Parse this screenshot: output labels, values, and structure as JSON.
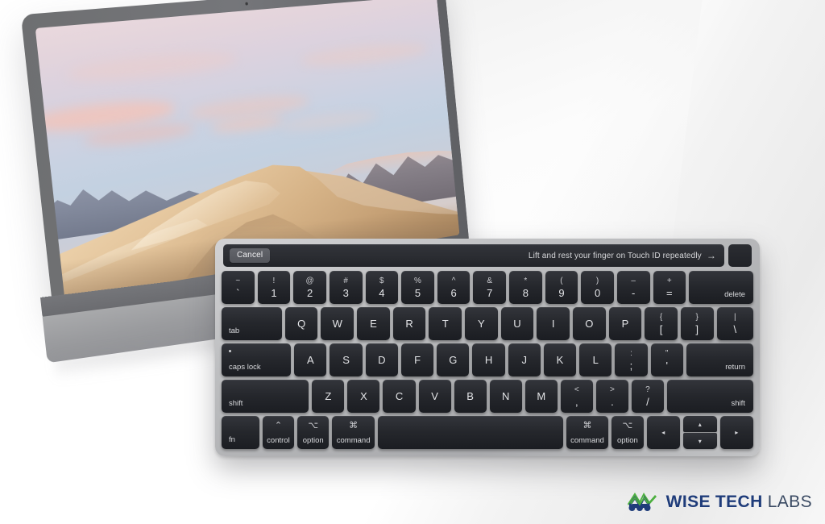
{
  "page": {
    "title": "MacBook Pro with Touch Bar — Touch ID enrollment"
  },
  "device": {
    "name": "macbook-pro",
    "wallpaper_name": "mojave-desert-dune",
    "bezel_color": "#6e6f71",
    "deck_color": "#9a9b9e"
  },
  "touchbar": {
    "cancel_label": "Cancel",
    "hint_text": "Lift and rest your finger on Touch ID repeatedly",
    "hint_arrow": "→",
    "background_color": "#2a2c31",
    "touchid_label": ""
  },
  "keyboard": {
    "body_color": "#bcbdbf",
    "key_color": "#25272c",
    "key_text_color": "#e3e4e7",
    "rows": [
      {
        "name": "number-row",
        "keys": [
          {
            "name": "key-backtick",
            "top": "~",
            "bottom": "`"
          },
          {
            "name": "key-1",
            "top": "!",
            "bottom": "1"
          },
          {
            "name": "key-2",
            "top": "@",
            "bottom": "2"
          },
          {
            "name": "key-3",
            "top": "#",
            "bottom": "3"
          },
          {
            "name": "key-4",
            "top": "$",
            "bottom": "4"
          },
          {
            "name": "key-5",
            "top": "%",
            "bottom": "5"
          },
          {
            "name": "key-6",
            "top": "^",
            "bottom": "6"
          },
          {
            "name": "key-7",
            "top": "&",
            "bottom": "7"
          },
          {
            "name": "key-8",
            "top": "*",
            "bottom": "8"
          },
          {
            "name": "key-9",
            "top": "(",
            "bottom": "9"
          },
          {
            "name": "key-0",
            "top": ")",
            "bottom": "0"
          },
          {
            "name": "key-minus",
            "top": "–",
            "bottom": "-"
          },
          {
            "name": "key-equal",
            "top": "+",
            "bottom": "="
          },
          {
            "name": "key-delete",
            "label": "delete"
          }
        ]
      },
      {
        "name": "top-letter-row",
        "keys": [
          {
            "name": "key-tab",
            "label": "tab"
          },
          {
            "name": "key-q",
            "label": "Q"
          },
          {
            "name": "key-w",
            "label": "W"
          },
          {
            "name": "key-e",
            "label": "E"
          },
          {
            "name": "key-r",
            "label": "R"
          },
          {
            "name": "key-t",
            "label": "T"
          },
          {
            "name": "key-y",
            "label": "Y"
          },
          {
            "name": "key-u",
            "label": "U"
          },
          {
            "name": "key-i",
            "label": "I"
          },
          {
            "name": "key-o",
            "label": "O"
          },
          {
            "name": "key-p",
            "label": "P"
          },
          {
            "name": "key-bracket-left",
            "top": "{",
            "bottom": "["
          },
          {
            "name": "key-bracket-right",
            "top": "}",
            "bottom": "]"
          },
          {
            "name": "key-backslash",
            "top": "|",
            "bottom": "\\"
          }
        ]
      },
      {
        "name": "home-row",
        "keys": [
          {
            "name": "key-caps-lock",
            "label": "caps lock"
          },
          {
            "name": "key-a",
            "label": "A"
          },
          {
            "name": "key-s",
            "label": "S"
          },
          {
            "name": "key-d",
            "label": "D"
          },
          {
            "name": "key-f",
            "label": "F"
          },
          {
            "name": "key-g",
            "label": "G"
          },
          {
            "name": "key-h",
            "label": "H"
          },
          {
            "name": "key-j",
            "label": "J"
          },
          {
            "name": "key-k",
            "label": "K"
          },
          {
            "name": "key-l",
            "label": "L"
          },
          {
            "name": "key-semicolon",
            "top": ":",
            "bottom": ";"
          },
          {
            "name": "key-quote",
            "top": "\"",
            "bottom": "'"
          },
          {
            "name": "key-return",
            "label": "return"
          }
        ]
      },
      {
        "name": "bottom-letter-row",
        "keys": [
          {
            "name": "key-shift-left",
            "label": "shift"
          },
          {
            "name": "key-z",
            "label": "Z"
          },
          {
            "name": "key-x",
            "label": "X"
          },
          {
            "name": "key-c",
            "label": "C"
          },
          {
            "name": "key-v",
            "label": "V"
          },
          {
            "name": "key-b",
            "label": "B"
          },
          {
            "name": "key-n",
            "label": "N"
          },
          {
            "name": "key-m",
            "label": "M"
          },
          {
            "name": "key-comma",
            "top": "<",
            "bottom": ","
          },
          {
            "name": "key-period",
            "top": ">",
            "bottom": "."
          },
          {
            "name": "key-slash",
            "top": "?",
            "bottom": "/"
          },
          {
            "name": "key-shift-right",
            "label": "shift"
          }
        ]
      },
      {
        "name": "modifier-row",
        "keys": [
          {
            "name": "key-fn",
            "label": "fn"
          },
          {
            "name": "key-control-left",
            "glyph": "⌃",
            "label": "control"
          },
          {
            "name": "key-option-left",
            "glyph": "⌥",
            "label": "option"
          },
          {
            "name": "key-command-left",
            "glyph": "⌘",
            "label": "command"
          },
          {
            "name": "key-space",
            "label": ""
          },
          {
            "name": "key-command-right",
            "glyph": "⌘",
            "label": "command"
          },
          {
            "name": "key-option-right",
            "glyph": "⌥",
            "label": "option"
          },
          {
            "name": "key-arrow-left",
            "label": "◂"
          },
          {
            "name": "key-arrow-up",
            "label": "▴"
          },
          {
            "name": "key-arrow-down",
            "label": "▾"
          },
          {
            "name": "key-arrow-right",
            "label": "▸"
          }
        ]
      }
    ]
  },
  "logo": {
    "word_one": "WISE",
    "word_two": "TECH",
    "word_three": "LABS",
    "primary_color": "#1f3c7a",
    "accent_color": "#4caf3f"
  }
}
